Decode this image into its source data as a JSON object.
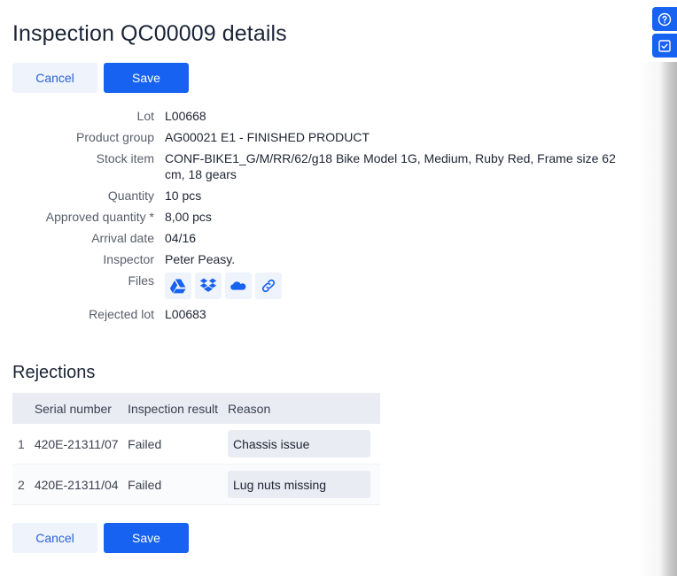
{
  "header": {
    "title": "Inspection QC00009 details"
  },
  "actions": {
    "cancel_label": "Cancel",
    "save_label": "Save"
  },
  "details": {
    "lot": {
      "label": "Lot",
      "value": "L00668"
    },
    "product_group": {
      "label": "Product group",
      "value": "AG00021 E1 - FINISHED PRODUCT"
    },
    "stock_item": {
      "label": "Stock item",
      "value": "CONF-BIKE1_G/M/RR/62/g18 Bike Model 1G, Medium, Ruby Red, Frame size 62 cm, 18 gears"
    },
    "quantity": {
      "label": "Quantity",
      "value": "10 pcs"
    },
    "approved_quantity": {
      "label": "Approved quantity *",
      "value": "8,00 pcs"
    },
    "arrival_date": {
      "label": "Arrival date",
      "value": "04/16"
    },
    "inspector": {
      "label": "Inspector",
      "value": "Peter Peasy."
    },
    "files": {
      "label": "Files",
      "icons": [
        "google-drive-icon",
        "dropbox-icon",
        "onedrive-icon",
        "link-icon"
      ]
    },
    "rejected_lot": {
      "label": "Rejected lot",
      "value": "L00683"
    }
  },
  "rejections": {
    "title": "Rejections",
    "columns": [
      "",
      "Serial number",
      "Inspection result",
      "Reason"
    ],
    "rows": [
      {
        "num": "1",
        "serial": "420E-21311/07",
        "result": "Failed",
        "reason": "Chassis issue"
      },
      {
        "num": "2",
        "serial": "420E-21311/04",
        "result": "Failed",
        "reason": "Lug nuts missing"
      }
    ]
  },
  "side_panel": {
    "buttons": [
      "help-icon",
      "checkbox-icon"
    ]
  },
  "colors": {
    "primary": "#1762f0",
    "secondary_bg": "#eef3fc",
    "table_header_bg": "#e9ecf2"
  }
}
